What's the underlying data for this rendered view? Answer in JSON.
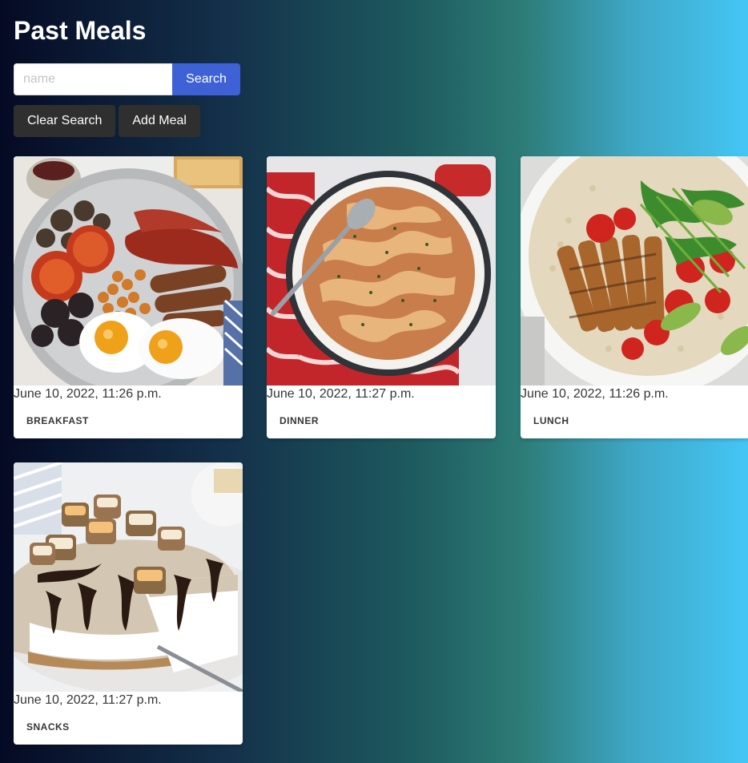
{
  "page": {
    "title": "Past Meals"
  },
  "search": {
    "placeholder": "name",
    "value": "",
    "button_label": "Search"
  },
  "actions": {
    "clear_label": "Clear Search",
    "add_label": "Add Meal"
  },
  "meals": [
    {
      "date": "June 10, 2022, 11:26 p.m.",
      "category": "BREAKFAST",
      "image": "full-breakfast-plate"
    },
    {
      "date": "June 10, 2022, 11:27 p.m.",
      "category": "DINNER",
      "image": "pasta-skillet"
    },
    {
      "date": "June 10, 2022, 11:26 p.m.",
      "category": "LUNCH",
      "image": "chicken-salad-bowl"
    },
    {
      "date": "June 10, 2022, 11:27 p.m.",
      "category": "SNACKS",
      "image": "cheesecake-slice"
    }
  ],
  "colors": {
    "primary_button": "#3e62d6",
    "dark_button": "#2f2f2f",
    "card_bg": "#ffffff",
    "gradient_start": "#050a24",
    "gradient_end": "#44c6f5"
  }
}
